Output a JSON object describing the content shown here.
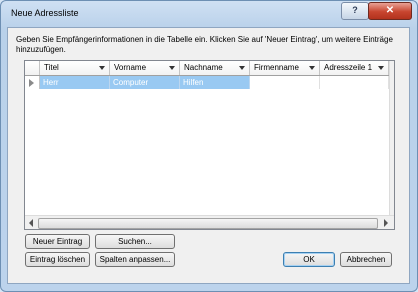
{
  "window": {
    "title": "Neue Adressliste"
  },
  "titlebar": {
    "help_label": "?",
    "close_label": "✕"
  },
  "instructions": "Geben Sie Empfängerinformationen in die Tabelle ein. Klicken Sie auf 'Neuer Eintrag', um weitere Einträge hinzuzufügen.",
  "table": {
    "columns": [
      "Titel",
      "Vorname",
      "Nachname",
      "Firmenname",
      "Adresszeile 1"
    ],
    "rows": [
      [
        "Herr",
        "Computer",
        "Hilfen",
        "",
        ""
      ]
    ]
  },
  "buttons": {
    "new_entry": "Neuer Eintrag",
    "search": "Suchen...",
    "delete_entry": "Eintrag löschen",
    "customize_columns": "Spalten anpassen...",
    "ok": "OK",
    "cancel": "Abbrechen"
  },
  "colors": {
    "selection": "#99c9f2",
    "window_frame": "#bcd3ec",
    "close_button": "#c8452f"
  }
}
